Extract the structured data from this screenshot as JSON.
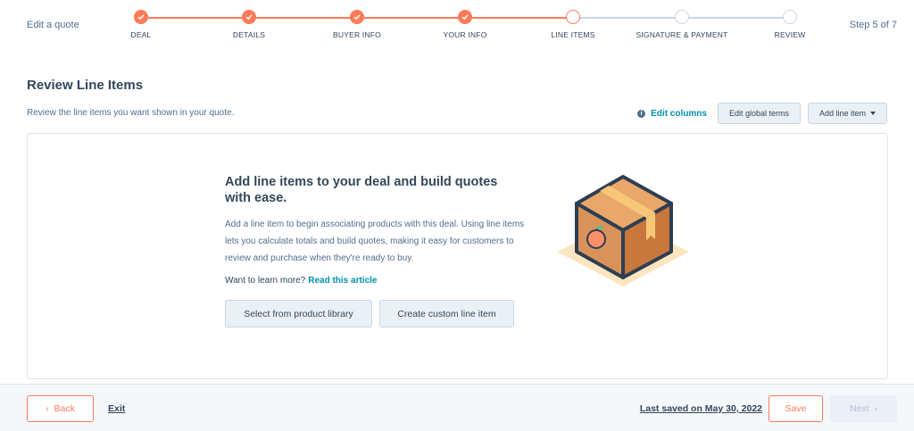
{
  "header": {
    "title": "Edit a quote",
    "step_count": "Step 5 of 7",
    "steps": [
      {
        "label": "DEAL",
        "state": "done"
      },
      {
        "label": "DETAILS",
        "state": "done"
      },
      {
        "label": "BUYER INFO",
        "state": "done"
      },
      {
        "label": "YOUR INFO",
        "state": "done"
      },
      {
        "label": "LINE ITEMS",
        "state": "current"
      },
      {
        "label": "SIGNATURE & PAYMENT",
        "state": "todo"
      },
      {
        "label": "REVIEW",
        "state": "todo"
      }
    ]
  },
  "section": {
    "title": "Review Line Items",
    "subtitle": "Review the line items you want shown in your quote.",
    "edit_columns": "Edit columns",
    "edit_global_terms": "Edit global terms",
    "add_line_item": "Add line item"
  },
  "empty_state": {
    "title": "Add line items to your deal and build quotes with ease.",
    "description": "Add a line item to begin associating products with this deal. Using line items lets you calculate totals and build quotes, making it easy for customers to review and purchase when they're ready to buy.",
    "learn_prefix": "Want to learn more?",
    "learn_link": "Read this article",
    "library_button": "Select from product library",
    "custom_button": "Create custom line item"
  },
  "footer": {
    "back": "Back",
    "exit": "Exit",
    "last_saved": "Last saved on May 30, 2022",
    "save": "Save",
    "next": "Next"
  },
  "colors": {
    "accent": "#ff7a59",
    "link": "#0091ae",
    "text": "#33475b",
    "muted": "#516f90",
    "box": "#d48a4e"
  }
}
